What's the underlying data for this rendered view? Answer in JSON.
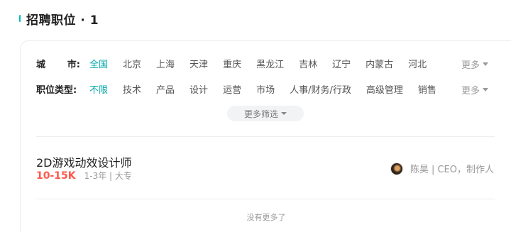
{
  "header": {
    "title": "招聘职位 · 1"
  },
  "filters": {
    "city": {
      "label": "城市:",
      "options": [
        "全国",
        "北京",
        "上海",
        "天津",
        "重庆",
        "黑龙江",
        "吉林",
        "辽宁",
        "内蒙古",
        "河北"
      ],
      "active_index": 0,
      "more_label": "更多"
    },
    "position_type": {
      "label": "职位类型:",
      "options": [
        "不限",
        "技术",
        "产品",
        "设计",
        "运营",
        "市场",
        "人事/财务/行政",
        "高级管理",
        "销售"
      ],
      "active_index": 0,
      "more_label": "更多"
    },
    "more_filters_label": "更多筛选"
  },
  "jobs": [
    {
      "title": "2D游戏动效设计师",
      "salary": "10-15K",
      "meta": "1-3年 | 大专",
      "recruiter": "陈昊 | CEO，制作人"
    }
  ],
  "footer": {
    "no_more": "没有更多了"
  },
  "colors": {
    "accent": "#00a6a7",
    "salary": "#fe574a",
    "header_bar": "#00bebd"
  }
}
